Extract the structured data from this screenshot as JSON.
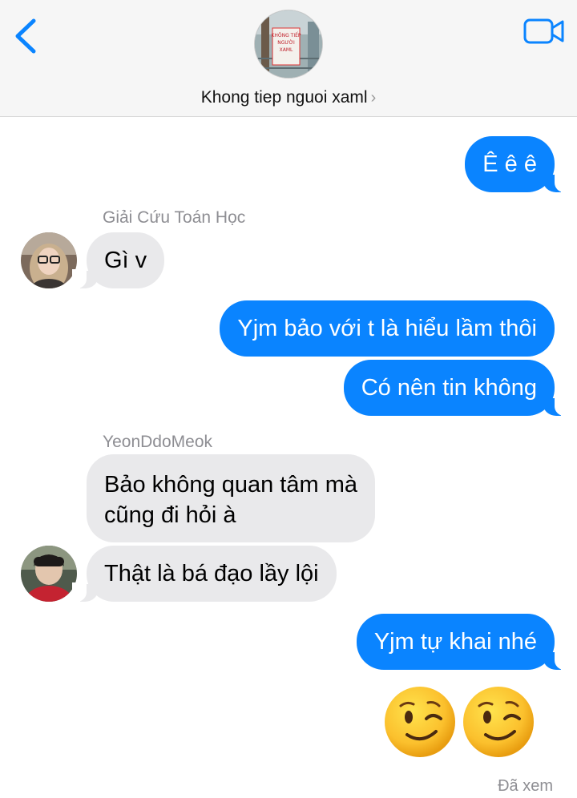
{
  "header": {
    "conversation_title": "Khong tiep nguoi xaml",
    "chevron": "›",
    "avatar_sign_text": "KHÔNG TIẾP NGƯỜI XAML"
  },
  "messages": [
    {
      "direction": "outgoing",
      "text": "Ê ê ê"
    },
    {
      "direction": "incoming",
      "sender": "Giải Cứu Toán Học",
      "text": "Gì v"
    },
    {
      "direction": "outgoing",
      "text": "Yjm bảo với t là hiểu lầm thôi"
    },
    {
      "direction": "outgoing",
      "text": "Có nên tin không"
    },
    {
      "direction": "incoming",
      "sender": "YeonDdoMeok",
      "text_line1": "Bảo không quan tâm mà",
      "text_line2": "cũng đi hỏi à"
    },
    {
      "direction": "incoming",
      "text": "Thật là bá đạo lầy lội"
    },
    {
      "direction": "outgoing",
      "text": "Yjm tự khai nhé"
    },
    {
      "direction": "outgoing",
      "emoji": [
        "winking-face",
        "winking-face"
      ]
    }
  ],
  "read_receipt": "Đã xem",
  "colors": {
    "outgoing_bubble": "#0a84ff",
    "incoming_bubble": "#e9e9eb",
    "accent": "#0a84ff"
  }
}
